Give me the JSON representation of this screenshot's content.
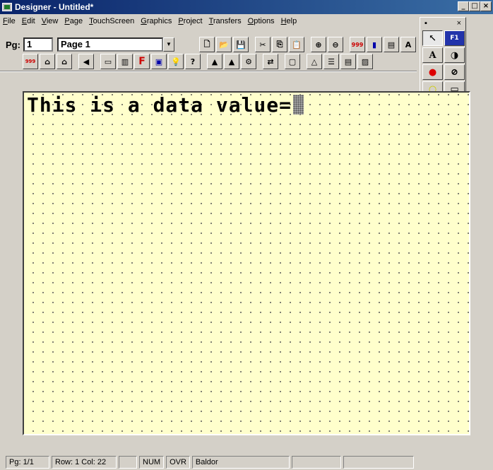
{
  "window": {
    "title": "Designer - Untitled*",
    "min": "_",
    "max": "□",
    "close": "×"
  },
  "menu": [
    "File",
    "Edit",
    "View",
    "Page",
    "TouchScreen",
    "Graphics",
    "Project",
    "Transfers",
    "Options",
    "Help"
  ],
  "page_selector": {
    "label": "Pg:",
    "number": "1",
    "page_name": "Page 1",
    "arrow": "▼"
  },
  "toolbar1": [
    "🗋",
    "📂",
    "💾",
    "✂",
    "⎘",
    "📋",
    "⊕",
    "⊖",
    "999",
    "▮",
    "▤",
    "A"
  ],
  "toolbar2": [
    "999",
    "⌂",
    "⌂",
    "◀",
    "▭",
    "▥",
    "F",
    "▣",
    "💡",
    "?",
    "▲",
    "▲",
    "⚙",
    "⇄",
    "▢",
    "△",
    "☰",
    "▤",
    "▨"
  ],
  "palette": {
    "title_left": "▪",
    "close": "×",
    "items": [
      "↖",
      "F1",
      "A",
      "◑",
      "●",
      "⊘",
      "○",
      "▭"
    ]
  },
  "canvas": {
    "text": "This is a data value="
  },
  "status": {
    "page": "Pg: 1/1",
    "row": "Row: 1  Col: 22",
    "num": "NUM",
    "ovr": "OVR",
    "font": "Baldor"
  },
  "colors": {
    "canvas_bg": "#ffffcc",
    "title_bar": "#0a246a",
    "chrome": "#d4d0c8"
  }
}
